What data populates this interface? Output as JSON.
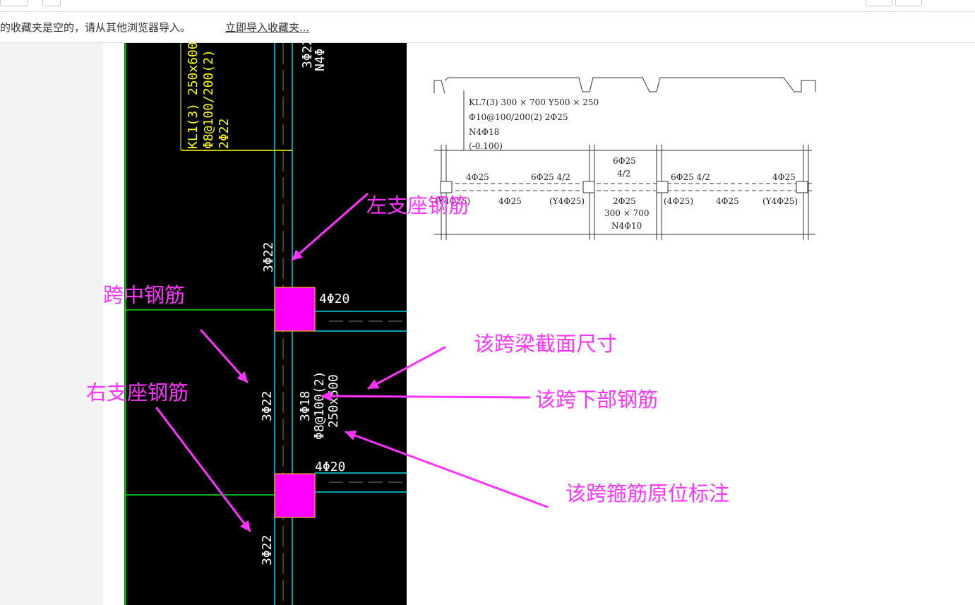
{
  "bookmarks_bar": {
    "empty_message": "的收藏夹是空的，请从其他浏览器导入。",
    "import_link": "立即导入收藏夹..."
  },
  "cad": {
    "beam_label": "KL1(3) 250x600",
    "beam_stirrup": "Φ8@100/200(2)",
    "beam_top": "2Φ22",
    "col_note_a": "3Φ22",
    "col_note_b": "N4Φ",
    "left_support_rebar": "3Φ22",
    "top_right_rebar_1": "4Φ20",
    "top_right_rebar_2": "4Φ20",
    "mid_rebar": "3Φ22",
    "bottom_rebar": "3Φ18",
    "span_stirrup": "Φ8@100(2)",
    "span_section": "250x500",
    "right_support_rebar": "3Φ22"
  },
  "annotations": {
    "left_support": "左支座钢筋",
    "mid_span": "跨中钢筋",
    "section_size": "该跨梁截面尺寸",
    "right_support": "右支座钢筋",
    "bottom_rebar": "该跨下部钢筋",
    "stirrup_note": "该跨箍筋原位标注"
  },
  "reference_drawing": {
    "line1": "KL7(3)  300 × 700  Y500 × 250",
    "line2": "Φ10@100/200(2)  2Φ25",
    "line3": "N4Φ18",
    "line4": "(-0.100)",
    "mid_top": "6Φ25",
    "mid_top_ratio": "4/2",
    "left_end": "4Φ25",
    "left_mid": "6Φ25  4/2",
    "right_mid": "6Φ25  4/2",
    "right_end": "4Φ25",
    "bot_left_a": "(Y4Φ25)",
    "bot_left_b": "4Φ25",
    "bot_left_c": "(Y4Φ25)",
    "bot_mid": "2Φ25",
    "bot_mid_size": "300 × 700",
    "bot_mid_n": "N4Φ10",
    "bot_right_a": "(4Φ25)",
    "bot_right_b": "4Φ25",
    "bot_right_c": "(Y4Φ25)"
  },
  "colors": {
    "annotation": "#ff33ff",
    "cad_background": "#000000",
    "cad_cyan": "#00d4e8",
    "cad_green": "#00e000",
    "cad_magenta": "#ff00ff",
    "cad_yellow": "#ffff00"
  }
}
